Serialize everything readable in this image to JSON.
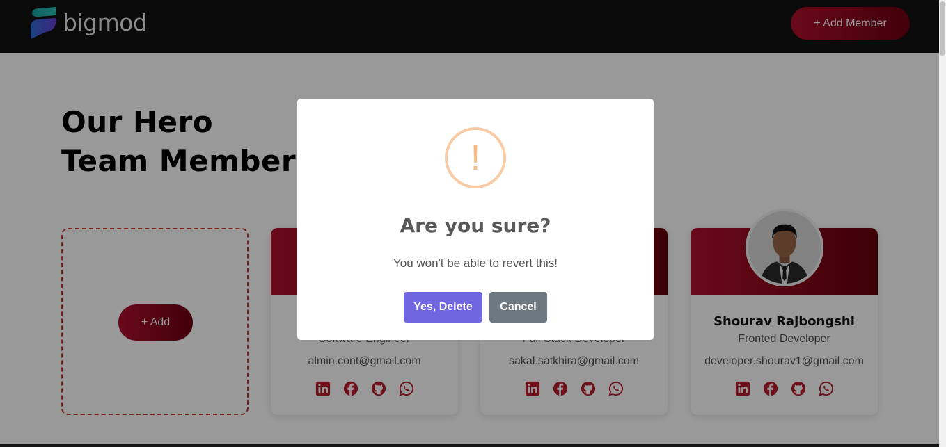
{
  "navbar": {
    "brand": "bigmod",
    "add_member_label": "+ Add Member"
  },
  "hero": {
    "line1": "Our Hero",
    "line2": "Team Members"
  },
  "add_card": {
    "button_label": "+ Add"
  },
  "members": [
    {
      "name": "",
      "role": "Software Engineer",
      "email": "almin.cont@gmail.com"
    },
    {
      "name": "",
      "role": "Full Stack Developer",
      "email": "sakal.satkhira@gmail.com"
    },
    {
      "name": "Shourav Rajbongshi",
      "role": "Fronted Developer",
      "email": "developer.shourav1@gmail.com"
    }
  ],
  "social_icons": [
    "linkedin-icon",
    "facebook-icon",
    "github-icon",
    "whatsapp-icon"
  ],
  "modal": {
    "icon": "warning-icon",
    "icon_glyph": "!",
    "title": "Are you sure?",
    "text": "You won't be able to revert this!",
    "confirm_label": "Yes, Delete",
    "cancel_label": "Cancel"
  },
  "colors": {
    "accent_red": "#b0102b",
    "confirm": "#7066e0",
    "cancel": "#6e7881",
    "warning": "#f8bb86",
    "social_icon": "#b81c2c"
  }
}
